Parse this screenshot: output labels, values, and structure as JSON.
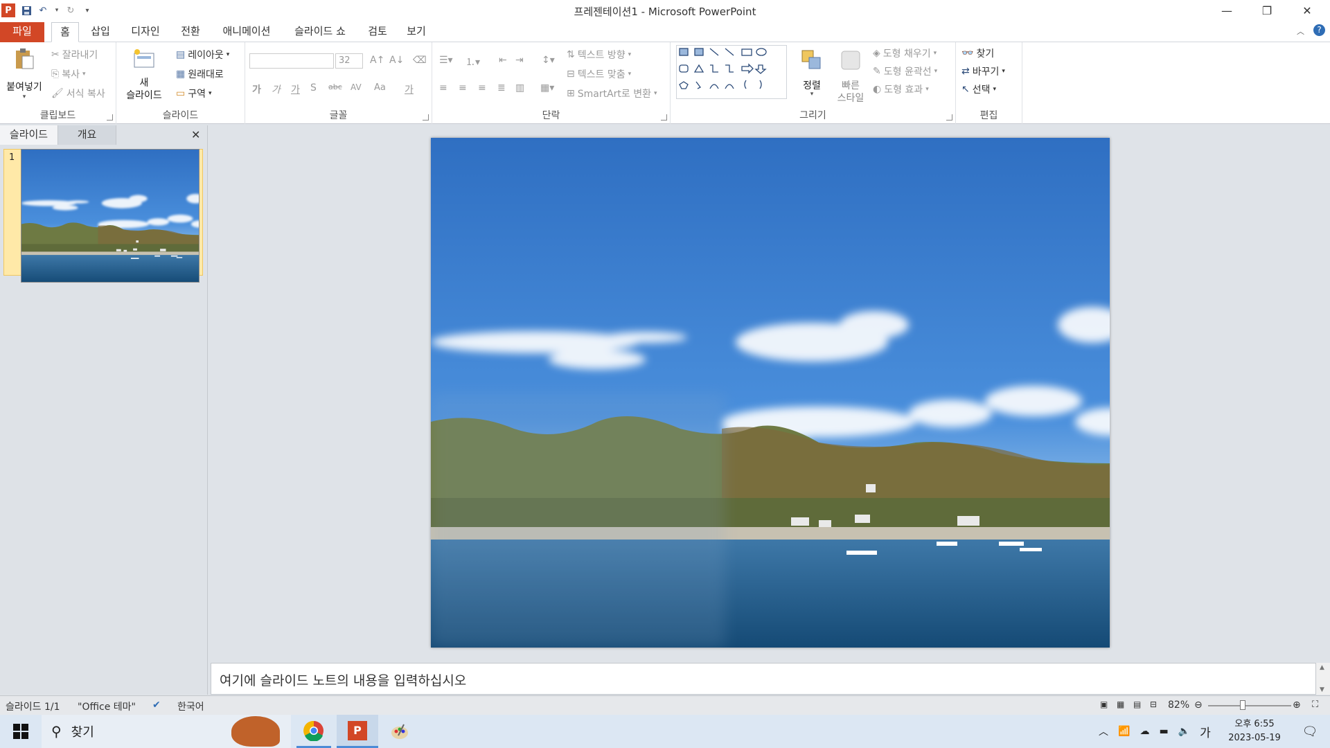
{
  "window": {
    "title": "프레젠테이션1 - Microsoft PowerPoint",
    "app_logo": "P",
    "controls": [
      "minimize-icon",
      "restore-icon",
      "close-icon"
    ]
  },
  "tabs": [
    {
      "label": "파일",
      "active": false,
      "file": true
    },
    {
      "label": "홈",
      "active": true
    },
    {
      "label": "삽입"
    },
    {
      "label": "디자인"
    },
    {
      "label": "전환"
    },
    {
      "label": "애니메이션"
    },
    {
      "label": "슬라이드 쇼"
    },
    {
      "label": "검토"
    },
    {
      "label": "보기"
    }
  ],
  "ribbon": {
    "clipboard": {
      "label": "클립보드",
      "paste": "붙여넣기",
      "cut": "잘라내기",
      "copy": "복사",
      "format_painter": "서식 복사"
    },
    "slides": {
      "label": "슬라이드",
      "new_slide_line1": "새",
      "new_slide_line2": "슬라이드",
      "layout": "레이아웃",
      "reset": "원래대로",
      "section": "구역"
    },
    "font": {
      "label": "글꼴",
      "font_name": "",
      "font_size": "32",
      "bold": "가",
      "italic": "가",
      "underline": "가",
      "strike": "S",
      "abc": "abc",
      "spacing": "AV",
      "case": "Aa",
      "color": "가"
    },
    "paragraph": {
      "label": "단락",
      "text_direction": "텍스트 방향",
      "align_text": "텍스트 맞춤",
      "smartart": "SmartArt로 변환"
    },
    "drawing": {
      "label": "그리기",
      "arrange": "정렬",
      "quick_styles_line1": "빠른",
      "quick_styles_line2": "스타일",
      "shape_fill": "도형 채우기",
      "shape_outline": "도형 윤곽선",
      "shape_effects": "도형 효과"
    },
    "editing": {
      "label": "편집",
      "find": "찾기",
      "replace": "바꾸기",
      "select": "선택"
    }
  },
  "left_pane": {
    "tab_slides": "슬라이드",
    "tab_outline": "개요",
    "slide_number": "1"
  },
  "notes": {
    "placeholder": "여기에 슬라이드 노트의 내용을 입력하십시오"
  },
  "status": {
    "slide": "슬라이드 1/1",
    "theme": "\"Office 테마\"",
    "language": "한국어",
    "zoom": "82%"
  },
  "taskbar": {
    "search": "찾기",
    "time": "오후 6:55",
    "date": "2023-05-19",
    "ime": "가"
  },
  "colors": {
    "accent": "#d24726",
    "sky": "#3a7dd1",
    "sea": "#1f5a86"
  }
}
